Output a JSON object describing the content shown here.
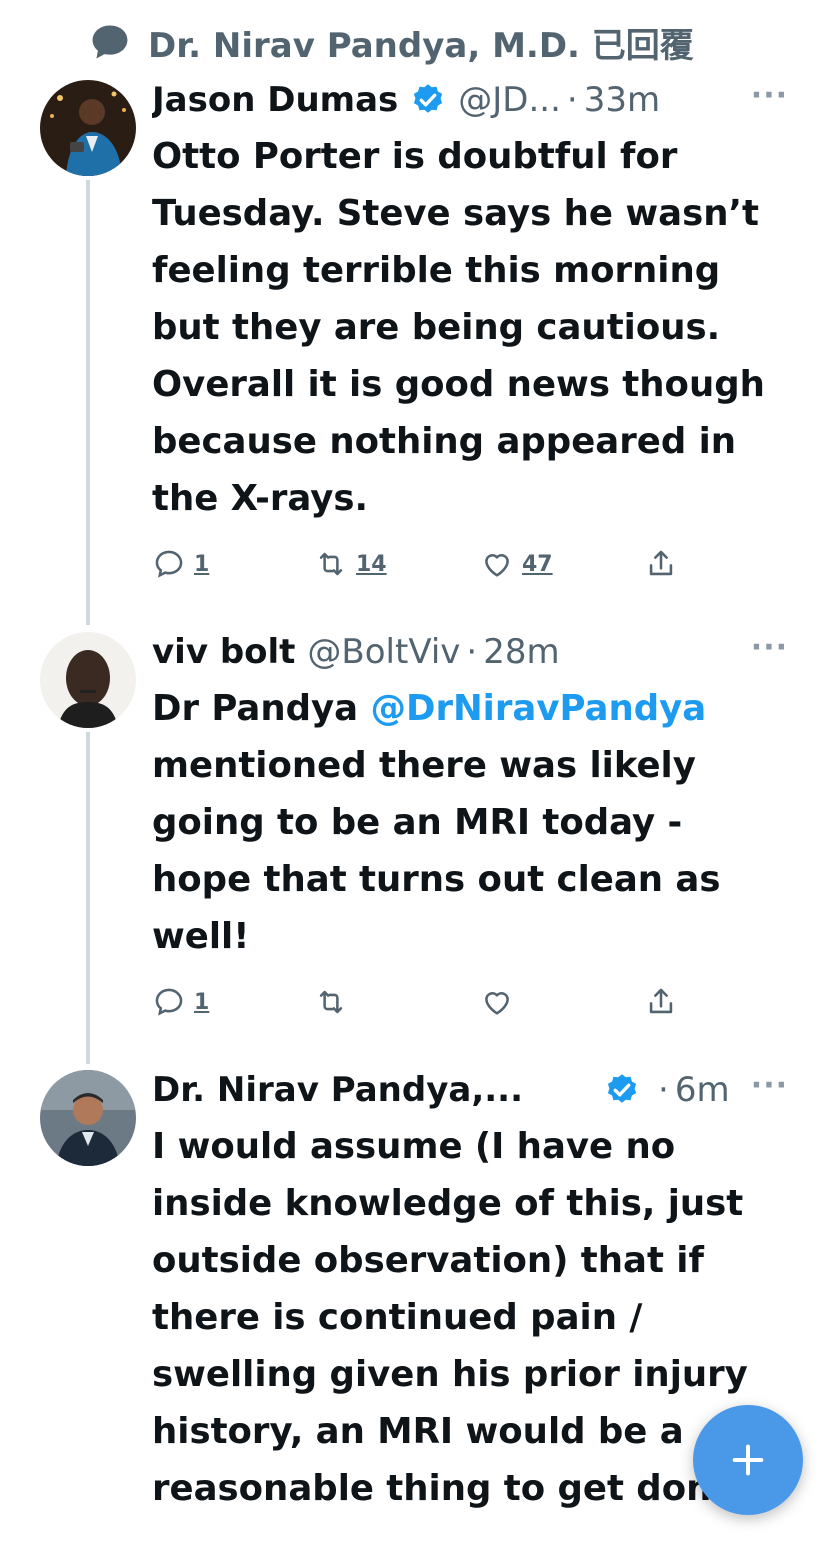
{
  "reply_context": {
    "text": "Dr. Nirav Pandya, M.D. 已回覆"
  },
  "tweets": [
    {
      "name": "Jason Dumas",
      "verified": true,
      "handle": "@JD...",
      "separator": "·",
      "time": "33m",
      "text": "Otto Porter is doubtful for Tuesday. Steve says he wasn’t feeling terrible this morning but they are being cautious. Overall it is good news though because nothing appeared in the X-rays.",
      "replies": "1",
      "retweets": "14",
      "likes": "47"
    },
    {
      "name": "viv bolt",
      "verified": false,
      "handle": "@BoltViv",
      "separator": "·",
      "time": "28m",
      "text_before": "Dr Pandya ",
      "mention": "@DrNiravPandya",
      "text_after": " mentioned there was likely going to be an MRI today - hope that turns out clean as well!",
      "replies": "1"
    },
    {
      "name": "Dr. Nirav Pandya,...",
      "verified": true,
      "separator": "·",
      "time": "6m",
      "text": "I would assume (I have no inside knowledge of this, just outside observation) that if there is continued pain / swelling given his prior injury history, an MRI would be a reasonable thing to get don"
    }
  ],
  "more_label": "···",
  "icons": {
    "reply_context": "speech-bubble-icon",
    "verified": "verified-badge-icon",
    "reply": "reply-icon",
    "retweet": "retweet-icon",
    "like": "heart-icon",
    "share": "share-icon",
    "compose": "plus-icon"
  },
  "colors": {
    "accent": "#1d9bf0",
    "fab": "#4a99e9",
    "secondary_text": "#536471",
    "thread_line": "#cfd9de"
  }
}
